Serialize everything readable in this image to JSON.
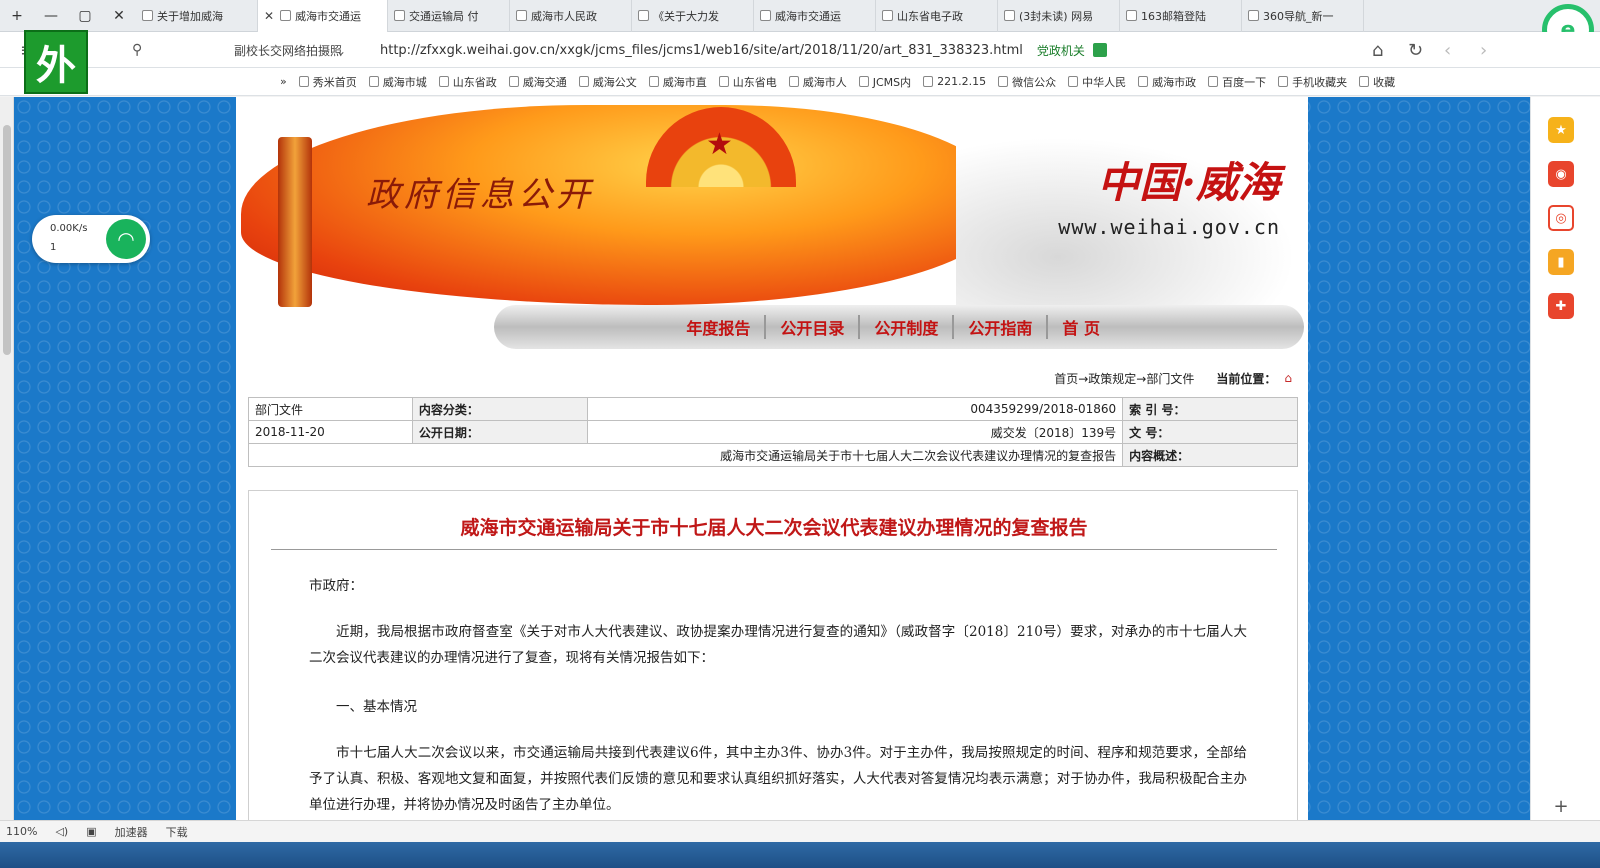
{
  "tabs": [
    {
      "label": "360导航_新一"
    },
    {
      "label": "163邮箱登陆"
    },
    {
      "label": "(3封未读) 网易"
    },
    {
      "label": "山东省电子政"
    },
    {
      "label": "威海市交通运"
    },
    {
      "label": "《关于大力发"
    },
    {
      "label": "威海市人民政"
    },
    {
      "label": "交通运输局 付"
    },
    {
      "label": "威海市交通运",
      "active": true
    },
    {
      "label": "关于增加威海"
    }
  ],
  "address": {
    "url": "http://zfxxgk.weihai.gov.cn/xxgk/jcms_files/jcms1/web16/site/art/2018/11/20/art_831_338323.html",
    "indicator": "党政机关",
    "search_text": "副校长交网络拍摄照"
  },
  "app_badge": "外",
  "logo360": "e",
  "bookmarks": [
    "收藏",
    "手机收藏夹",
    "百度一下",
    "威海市政",
    "中华人民",
    "微信公众",
    "221.2.15",
    "JCMS内",
    "威海市人",
    "山东省电",
    "威海市直",
    "威海公文",
    "威海交通",
    "山东省政",
    "威海市城",
    "秀米首页",
    "»"
  ],
  "banner": {
    "title": "政府信息公开",
    "site_name": "中国·威海",
    "site_url": "www.weihai.gov.cn",
    "emblem": "★"
  },
  "menu": [
    "首 页",
    "公开指南",
    "公开制度",
    "公开目录",
    "年度报告"
  ],
  "location": {
    "label": "当前位置：",
    "path": "首页→政策规定→部门文件"
  },
  "meta": {
    "index_label": "索 引 号：",
    "index_value": "004359299/2018-01860",
    "category_label": "内容分类：",
    "category_value": "部门文件",
    "docno_label": "文    号：",
    "docno_value": "威交发〔2018〕139号",
    "date_label": "公开日期：",
    "date_value": "2018-11-20",
    "summary_label": "内容概述：",
    "summary_value": "威海市交通运输局关于市十七届人大二次会议代表建议办理情况的复查报告"
  },
  "document": {
    "title": "威海市交通运输局关于市十七届人大二次会议代表建议办理情况的复查报告",
    "salutation": "市政府：",
    "p1": "近期，我局根据市政府督查室《关于对市人大代表建议、政协提案办理情况进行复查的通知》（威政督字〔2018〕210号）要求，对承办的市十七届人大二次会议代表建议的办理情况进行了复查，现将有关情况报告如下：",
    "h1": "一、基本情况",
    "p2": "市十七届人大二次会议以来，市交通运输局共接到代表建议6件，其中主办3件、协办3件。对于主办件，我局按照规定的时间、程序和规范要求，全部给予了认真、积极、客观地文复和面复，并按照代表们反馈的意见和要求认真组织抓好落实，人大代表对答复情况均表示满意；对于协办件，我局积极配合主办单位进行办理，并将协办情况及时函告了主办单位。"
  },
  "wifi": {
    "rate": "0.00K/s",
    "count": "1"
  },
  "status": {
    "zoom": "110%",
    "items": [
      "下载",
      "加速器"
    ]
  }
}
